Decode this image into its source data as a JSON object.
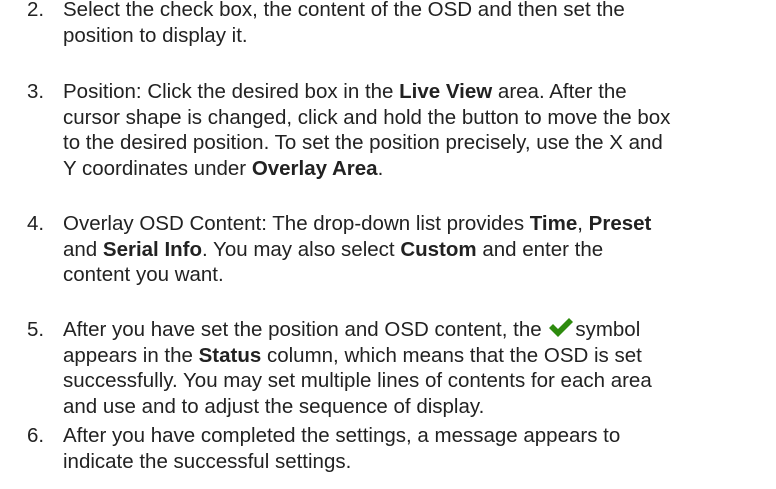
{
  "steps": [
    {
      "number": "2.",
      "lines": [
        "Select the check box, the content of the OSD and then set the",
        "position to display it."
      ]
    },
    {
      "number": "3.",
      "l1_a": "Position: Click the desired box in the ",
      "l1_b": "Live View",
      "l1_c": " area. After the",
      "l2": "cursor shape is changed, click and hold the button to move the box",
      "l3": "to the desired position. To set the position precisely, use the X and",
      "l4_a": "Y coordinates under ",
      "l4_b": "Overlay Area",
      "l4_c": "."
    },
    {
      "number": "4.",
      "l1_a": "Overlay OSD Content: The drop-down list provides ",
      "l1_b": "Time",
      "l1_c": ", ",
      "l1_d": "Preset",
      "l2_a": "and ",
      "l2_b": "Serial Info",
      "l2_c": ". You may also select ",
      "l2_d": "Custom",
      "l2_e": " and enter the",
      "l3": "content you want."
    },
    {
      "number": "5.",
      "l1_a": "After you have set the position and OSD content, the ",
      "l1_b": "symbol",
      "l2_a": "appears in the ",
      "l2_b": "Status",
      "l2_c": " column, which means that the OSD is set",
      "l3": "successfully. You may set multiple lines of contents for each area",
      "l4": "and use and to adjust the sequence of display.",
      "check_color": "#2e8b0e"
    },
    {
      "number": "6.",
      "lines": [
        "After you have completed the settings, a message appears to",
        "indicate the successful settings."
      ]
    }
  ]
}
